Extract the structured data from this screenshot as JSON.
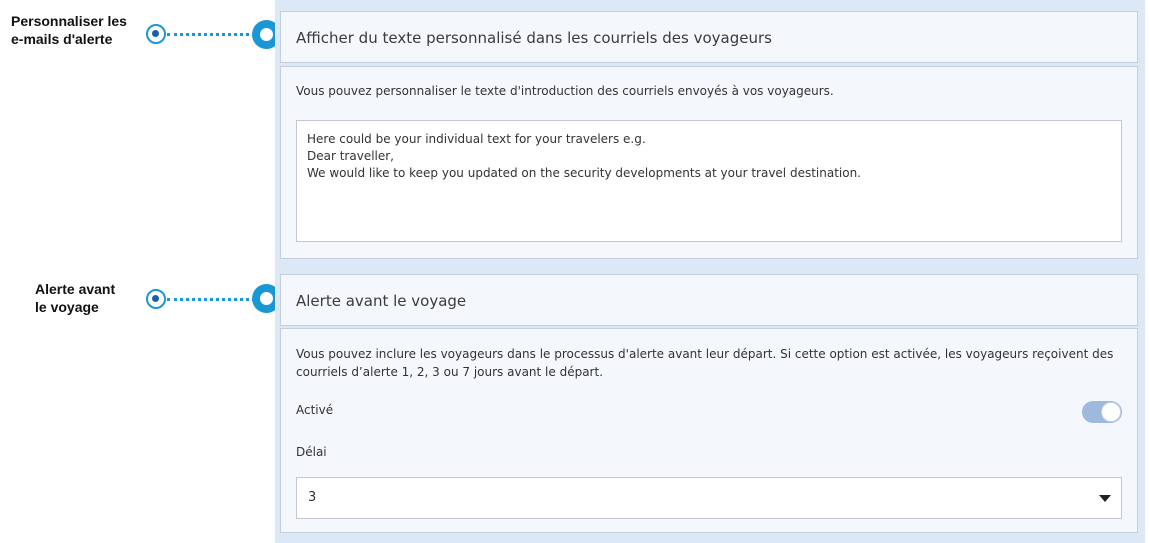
{
  "annotations": {
    "custom_text": {
      "line1": "Personnaliser les",
      "line2": "e-mails d'alerte"
    },
    "pre_trip": {
      "line1": "Alerte avant",
      "line2": "le voyage"
    }
  },
  "custom_email_section": {
    "title": "Afficher du texte personnalisé dans les courriels des voyageurs",
    "description": "Vous pouvez personnaliser le texte d'introduction des courriels envoyés à vos voyageurs.",
    "text_lines": [
      "Here could be your individual text for your travelers e.g.",
      "Dear traveller,",
      "We would like to keep you updated on the security developments at your travel destination."
    ]
  },
  "pre_trip_section": {
    "title": "Alerte avant le voyage",
    "description_line1": "Vous pouvez inclure les voyageurs dans le processus d'alerte avant leur départ. Si cette option est activée, les voyageurs reçoivent des",
    "description_line2": "courriels d’alerte 1, 2, 3 ou 7 jours avant le départ.",
    "enabled_label": "Activé",
    "enabled": true,
    "delay_label": "Délai",
    "delay_value": "3"
  },
  "colors": {
    "accent": "#1a97d5",
    "panel_bg": "#dde8f6",
    "toggle_on": "#9fb9dd"
  }
}
